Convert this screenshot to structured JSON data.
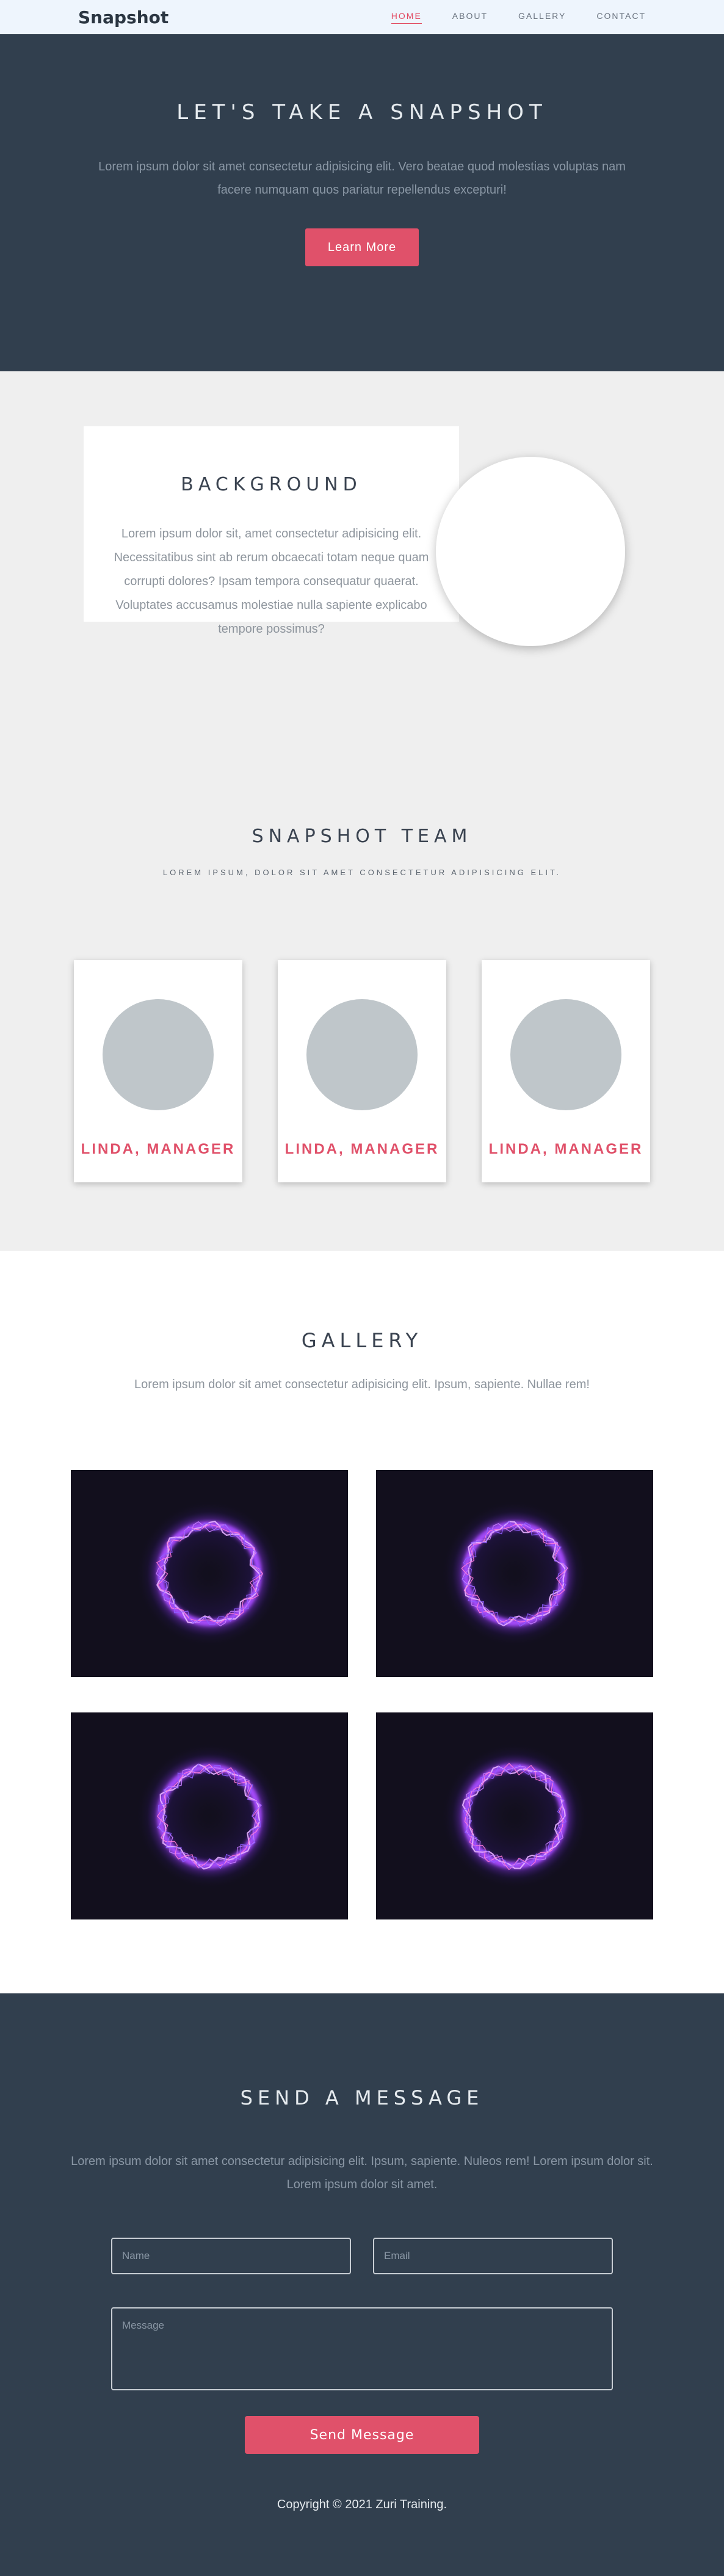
{
  "nav": {
    "brand": "Snapshot",
    "links": [
      {
        "label": "HOME"
      },
      {
        "label": "ABOUT"
      },
      {
        "label": "GALLERY"
      },
      {
        "label": "CONTACT"
      }
    ]
  },
  "hero": {
    "title": "LET'S TAKE A SNAPSHOT",
    "text": "Lorem ipsum dolor sit amet consectetur adipisicing elit. Vero beatae quod molestias voluptas nam facere numquam quos pariatur repellendus excepturi!",
    "button": "Learn More"
  },
  "background": {
    "title": "BACKGROUND",
    "text": "Lorem ipsum dolor sit, amet consectetur adipisicing elit. Necessitatibus sint ab rerum obcaecati totam neque quam corrupti dolores? Ipsam tempora consequatur quaerat. Voluptates accusamus molestiae nulla sapiente explicabo tempore possimus?"
  },
  "team": {
    "title": "SNAPSHOT TEAM",
    "subtitle": "LOREM IPSUM, DOLOR SIT AMET CONSECTETUR ADIPISICING ELIT.",
    "members": [
      {
        "name": "LINDA, MANAGER"
      },
      {
        "name": "LINDA, MANAGER"
      },
      {
        "name": "LINDA, MANAGER"
      }
    ]
  },
  "gallery": {
    "title": "GALLERY",
    "subtitle": "Lorem ipsum dolor sit amet consectetur adipisicing elit. Ipsum, sapiente. Nullae rem!"
  },
  "contact": {
    "title": "SEND A MESSAGE",
    "text": "Lorem ipsum dolor sit amet consectetur adipisicing elit. Ipsum, sapiente. Nuleos rem! Lorem ipsum dolor sit. Lorem ipsum dolor sit amet.",
    "name_placeholder": "Name",
    "email_placeholder": "Email",
    "message_placeholder": "Message",
    "button": "Send Message"
  },
  "footer": {
    "text": "Copyright © 2021 Zuri Training."
  },
  "colors": {
    "accent": "#e0516a",
    "dark": "#313f4e",
    "light": "#efefef"
  }
}
